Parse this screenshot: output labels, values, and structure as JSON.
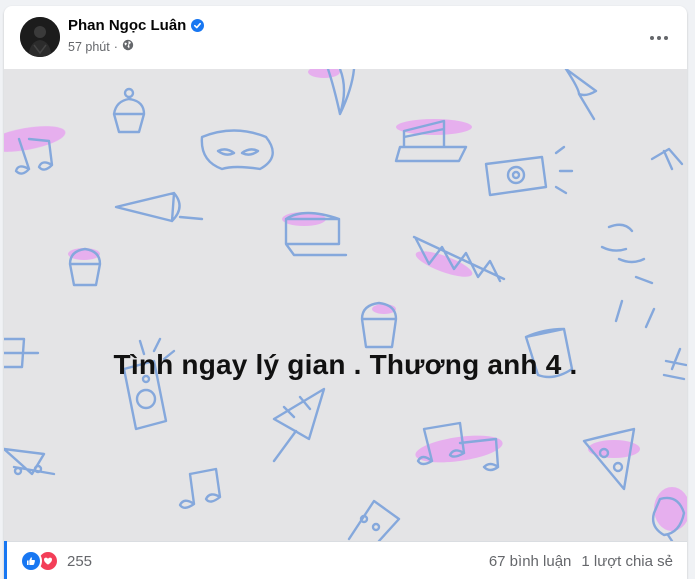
{
  "post": {
    "author": "Phan Ngọc Luân",
    "time": "57 phút",
    "separator": "·",
    "verified_icon": "verified-badge-icon",
    "privacy_icon": "globe-icon",
    "menu_icon": "more-options-icon"
  },
  "banner": {
    "text": "Tình ngay lý gian . Thương anh 4 .",
    "background_color": "#e4e4e6",
    "doodle_color": "#85a8dc",
    "highlight_color": "#e7a6f0"
  },
  "footer": {
    "reaction_count": "255",
    "comments": "67 bình luận",
    "shares": "1 lượt chia sẻ",
    "reaction_icons": [
      "like-icon",
      "love-icon"
    ]
  },
  "colors": {
    "accent": "#1877f2",
    "love": "#f33e58",
    "secondary_text": "#65676b"
  }
}
